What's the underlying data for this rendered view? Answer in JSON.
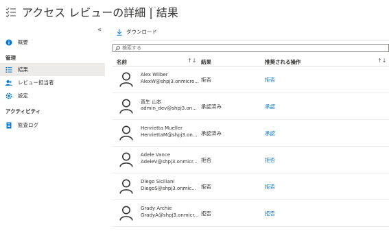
{
  "header": {
    "title": "アクセス レビューの詳細 | 結果",
    "more": "···"
  },
  "sidebar": {
    "collapse": "«",
    "overview": "概要",
    "manage_section": "管理",
    "results": "結果",
    "reviewers": "レビュー担当者",
    "settings": "設定",
    "activity_section": "アクティビティ",
    "audit_log": "監査ログ"
  },
  "toolbar": {
    "download_label": "ダウンロード"
  },
  "search": {
    "placeholder": "検索する"
  },
  "table": {
    "columns": {
      "name": "名前",
      "result": "結果",
      "recommended": "推奨される操作"
    },
    "sort_icon": "↑↓",
    "rows": [
      {
        "name": "Alex Wilber",
        "email": "AlexW@shpj3.onmicro...",
        "result": "拒否",
        "action": "拒否"
      },
      {
        "name": "真生 山本",
        "email": "admin_dev@shpj3.on...",
        "result": "承認済み",
        "action": "承認"
      },
      {
        "name": "Henrietta Mueller",
        "email": "HenriettaM@shpj3.on...",
        "result": "承認済み",
        "action": "承認"
      },
      {
        "name": "Adele Vance",
        "email": "AdeleV@shpj3.onmicr...",
        "result": "拒否",
        "action": "拒否"
      },
      {
        "name": "Diego Siciliani",
        "email": "DiegoS@shpj3.onmic...",
        "result": "拒否",
        "action": "拒否"
      },
      {
        "name": "Grady Archie",
        "email": "GradyA@shpj3.onmicr...",
        "result": "拒否",
        "action": "拒否"
      }
    ]
  },
  "colors": {
    "link": "#0078d4",
    "active_bg": "#edebe9",
    "text": "#323130"
  },
  "icons": {
    "title": "checklist-icon",
    "overview": "info-icon",
    "results": "list-icon",
    "reviewers": "people-icon",
    "settings": "gear-icon",
    "audit_log": "log-icon",
    "download": "download-icon",
    "search": "search-icon",
    "avatar": "person-icon"
  }
}
